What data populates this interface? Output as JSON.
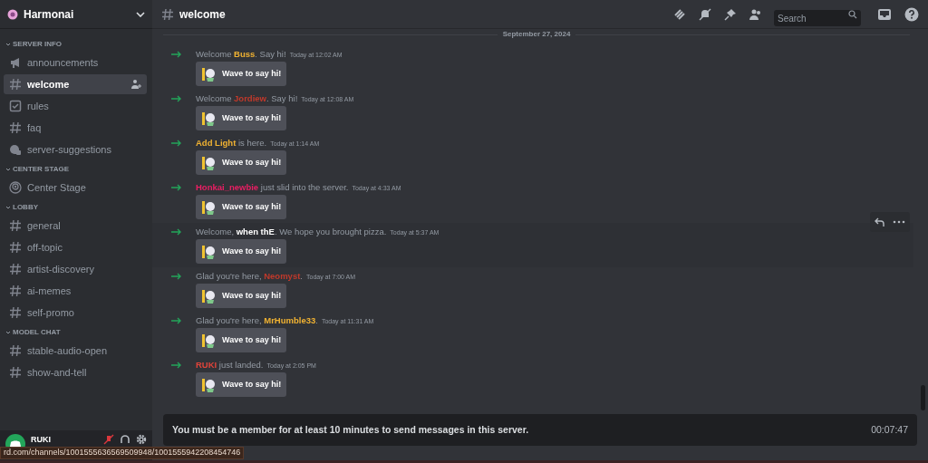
{
  "server": {
    "name": "Harmonai"
  },
  "sidebar": {
    "categories": [
      {
        "name": "SERVER INFO",
        "expanded": true,
        "channels": [
          {
            "name": "announcements",
            "kind": "announcement",
            "selected": false
          },
          {
            "name": "welcome",
            "kind": "text",
            "selected": true
          },
          {
            "name": "rules",
            "kind": "rules",
            "selected": false
          },
          {
            "name": "faq",
            "kind": "text",
            "selected": false
          },
          {
            "name": "server-suggestions",
            "kind": "forum",
            "selected": false
          }
        ]
      },
      {
        "name": "CENTER STAGE",
        "expanded": true,
        "channels": [
          {
            "name": "Center Stage",
            "kind": "stage",
            "selected": false
          }
        ]
      },
      {
        "name": "LOBBY",
        "expanded": true,
        "channels": [
          {
            "name": "general",
            "kind": "text",
            "selected": false
          },
          {
            "name": "off-topic",
            "kind": "text",
            "selected": false
          },
          {
            "name": "artist-discovery",
            "kind": "text",
            "selected": false
          },
          {
            "name": "ai-memes",
            "kind": "text",
            "selected": false
          },
          {
            "name": "self-promo",
            "kind": "text",
            "selected": false
          }
        ]
      },
      {
        "name": "MODEL CHAT",
        "expanded": true,
        "channels": [
          {
            "name": "stable-audio-open",
            "kind": "text",
            "selected": false
          },
          {
            "name": "show-and-tell",
            "kind": "text",
            "selected": false
          }
        ]
      }
    ]
  },
  "user": {
    "name": "RUKI"
  },
  "status_url": "rd.com/channels/1001555636569509948/1001555942208454746",
  "channel_header": {
    "name": "welcome",
    "search_placeholder": "Search"
  },
  "date_divider": "September 27, 2024",
  "messages": [
    {
      "prefix": "Welcome ",
      "name": "Buss",
      "color": "#f0b232",
      "suffix": ". Say hi!",
      "time": "Today at 12:02 AM",
      "button": "Wave to say hi!",
      "hovered": false
    },
    {
      "prefix": "Welcome ",
      "name": "Jordiew",
      "color": "#c0392b",
      "suffix": ". Say hi!",
      "time": "Today at 12:08 AM",
      "button": "Wave to say hi!",
      "hovered": false
    },
    {
      "name": "Add Light",
      "color": "#f0b232",
      "suffix": " is here.",
      "time": "Today at 1:14 AM",
      "button": "Wave to say hi!",
      "hovered": false
    },
    {
      "name": "Honkai_newbie",
      "color": "#e91e63",
      "suffix": " just slid into the server.",
      "time": "Today at 4:33 AM",
      "button": "Wave to say hi!",
      "hovered": false
    },
    {
      "prefix": "Welcome, ",
      "name": "when thE",
      "color": "#ffffff",
      "suffix": ". We hope you brought pizza.",
      "time": "Today at 5:37 AM",
      "button": "Wave to say hi!",
      "hovered": true
    },
    {
      "prefix": "Glad you're here, ",
      "name": "Neomyst",
      "color": "#c0392b",
      "suffix": ".",
      "time": "Today at 7:00 AM",
      "button": "Wave to say hi!",
      "hovered": false
    },
    {
      "prefix": "Glad you're here, ",
      "name": "MrHumble33",
      "color": "#f0b232",
      "suffix": ".",
      "time": "Today at 11:31 AM",
      "button": "Wave to say hi!",
      "hovered": false
    },
    {
      "name": "RUKI",
      "color": "#e0443a",
      "suffix": " just landed.",
      "time": "Today at 2:05 PM",
      "button": "Wave to say hi!",
      "hovered": false
    }
  ],
  "composer_notice": {
    "text": "You must be a member for at least 10 minutes to send messages in this server.",
    "timer": "00:07:47"
  }
}
